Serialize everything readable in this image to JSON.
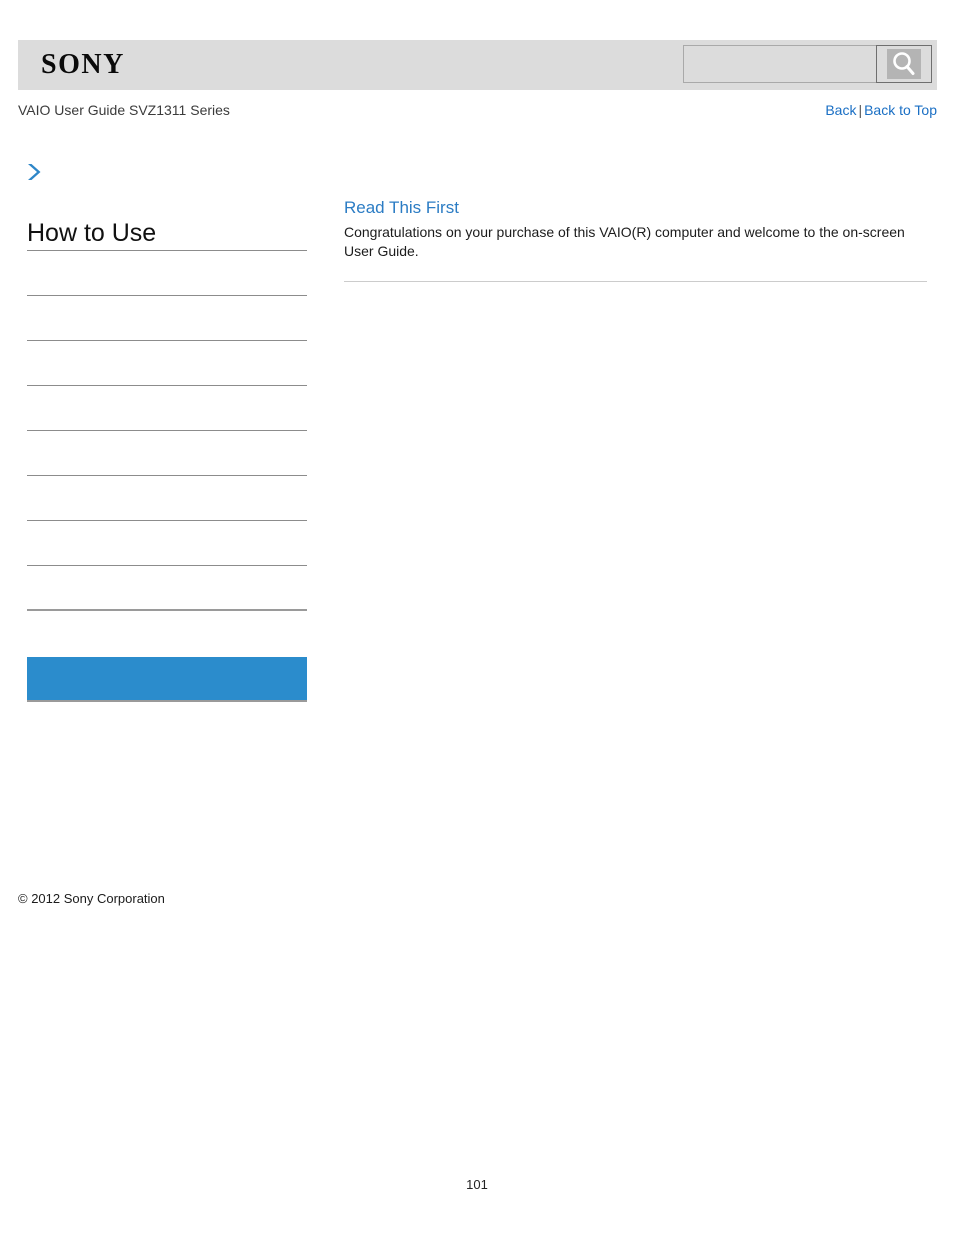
{
  "header": {
    "logo_text": "SONY",
    "search": {
      "value": "",
      "placeholder": "",
      "button_icon": "search-icon"
    }
  },
  "subheader": {
    "guide_title": "VAIO User Guide SVZ1311 Series",
    "links": {
      "back": "Back",
      "separator": "|",
      "back_to_top": "Back to Top"
    }
  },
  "sidebar": {
    "chevron_icon": "chevron-right-icon",
    "heading": "How to Use",
    "items": [
      {
        "label": ""
      },
      {
        "label": ""
      },
      {
        "label": ""
      },
      {
        "label": ""
      },
      {
        "label": ""
      },
      {
        "label": ""
      },
      {
        "label": ""
      },
      {
        "label": ""
      },
      {
        "label": "",
        "selected": true
      }
    ],
    "copyright": "© 2012 Sony Corporation"
  },
  "content": {
    "title": "Read This First",
    "body": "Congratulations on your purchase of this VAIO(R) computer and welcome to the on-screen User Guide."
  },
  "footer": {
    "page_number": "101"
  },
  "colors": {
    "header_bg": "#dcdcdc",
    "link_blue": "#1a6fc4",
    "title_blue": "#2b7cc4",
    "selected_blue": "#2b8ccc",
    "rule_gray": "#8c8c8c"
  }
}
